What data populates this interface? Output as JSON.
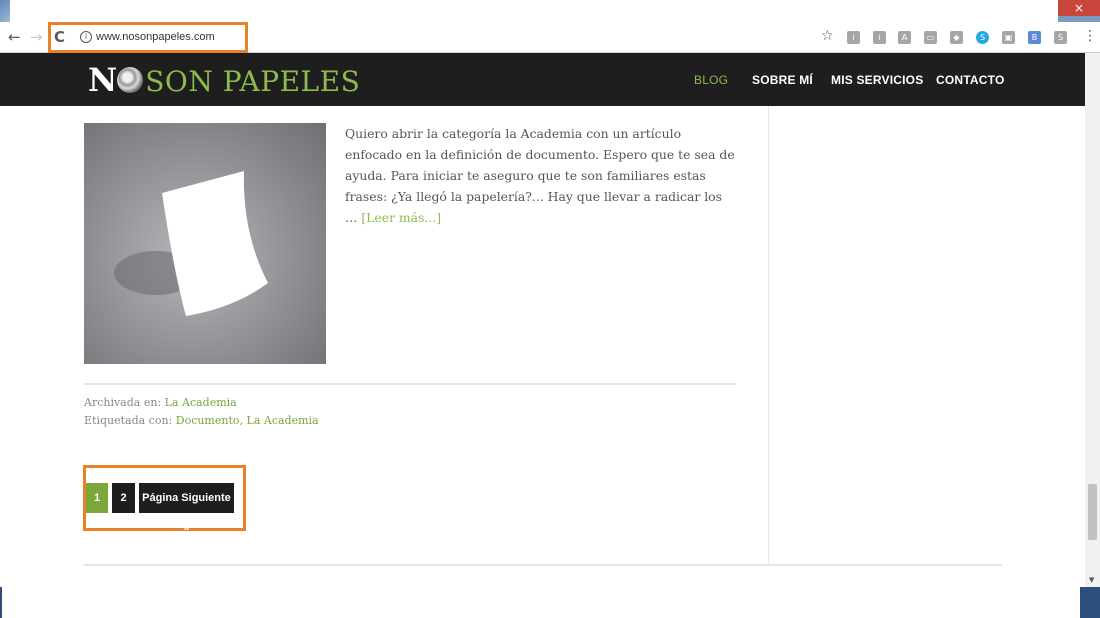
{
  "browser": {
    "close_label": "×",
    "back_icon": "←",
    "forward_icon": "→",
    "reload_icon": "C",
    "info_icon": "i",
    "url": "www.nosonpapeles.com",
    "star_icon": "☆",
    "extensions": [
      "i",
      "i",
      "A",
      "▭",
      "◆",
      "S",
      "▣",
      "B",
      "S"
    ],
    "menu_icon": "⋮"
  },
  "site": {
    "logo_n": "N",
    "logo_rest": "SON PAPELES",
    "nav": [
      {
        "label": "BLOG",
        "active": true
      },
      {
        "label": "SOBRE MÍ",
        "active": false
      },
      {
        "label": "MIS SERVICIOS",
        "active": false
      },
      {
        "label": "CONTACTO",
        "active": false
      }
    ],
    "accent_color": "#8dbb4c",
    "header_bg": "#1e1e1e"
  },
  "post": {
    "excerpt": "Quiero abrir la categoría la Academia con un artículo enfocado en la definición de documento. Espero que te sea de ayuda. Para iniciar te aseguro que te son familiares estas frases: ¿Ya llegó la papelería?... Hay que llevar a radicar los … ",
    "read_more": "[Leer más...]",
    "archived_label": "Archivada en: ",
    "archived_link": "La Academia",
    "tagged_label": "Etiquetada con: ",
    "tag_1": "Documento",
    "tag_sep": ", ",
    "tag_2": "La Academia"
  },
  "pagination": {
    "pages": [
      "1",
      "2"
    ],
    "current": "1",
    "next_label": "Página Siguiente »"
  },
  "highlight_color": "#e8822a"
}
